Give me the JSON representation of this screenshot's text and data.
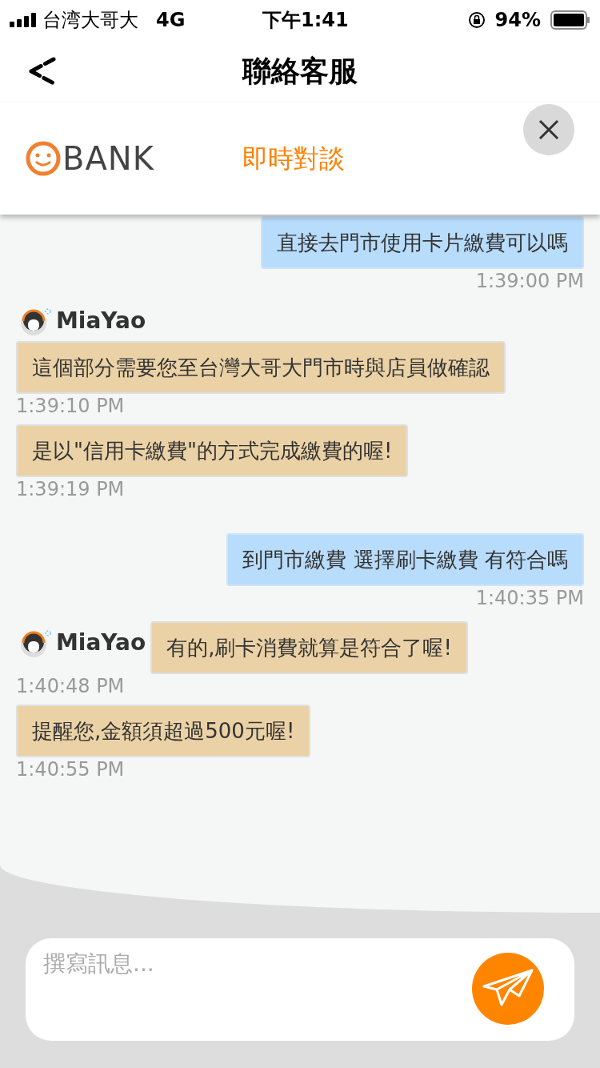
{
  "status_bar": {
    "carrier": "台湾大哥大",
    "network": "4G",
    "time": "下午1:41",
    "battery": "94%"
  },
  "nav": {
    "title": "聯絡客服"
  },
  "header": {
    "logo_text": "BANK",
    "title": "即時對談"
  },
  "messages": [
    {
      "kind": "user",
      "text": "直接去門市使用卡片繳費可以嗎",
      "time": "1:39:00 PM"
    },
    {
      "kind": "agent_header",
      "sender": "MiaYao",
      "text": "這個部分需要您至台灣大哥大門市時與店員做確認",
      "time": "1:39:10 PM"
    },
    {
      "kind": "agent",
      "text": "是以\"信用卡繳費\"的方式完成繳費的喔!",
      "time": "1:39:19 PM"
    },
    {
      "kind": "user",
      "text": "到門市繳費 選擇刷卡繳費 有符合嗎",
      "time": "1:40:35 PM"
    },
    {
      "kind": "agent_beside",
      "sender": "MiaYao",
      "text": "有的,刷卡消費就算是符合了喔!",
      "time": "1:40:48 PM"
    },
    {
      "kind": "agent",
      "text": "提醒您,金額須超過500元喔!",
      "time": "1:40:55 PM"
    }
  ],
  "composer": {
    "placeholder": "撰寫訊息..."
  }
}
